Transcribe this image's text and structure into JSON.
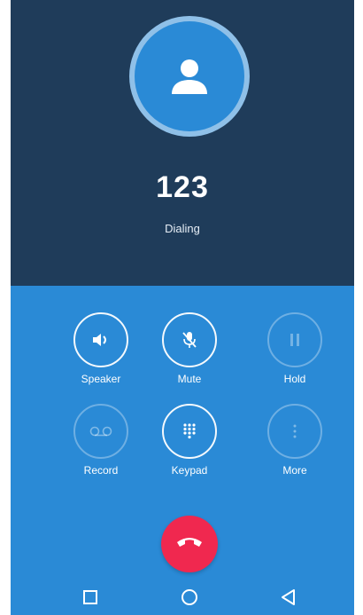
{
  "call": {
    "number": "123",
    "status": "Dialing"
  },
  "controls": {
    "speaker": {
      "label": "Speaker",
      "icon": "speaker-icon",
      "enabled": true
    },
    "mute": {
      "label": "Mute",
      "icon": "mic-off-icon",
      "enabled": true
    },
    "hold": {
      "label": "Hold",
      "icon": "pause-icon",
      "enabled": false
    },
    "record": {
      "label": "Record",
      "icon": "voicemail-icon",
      "enabled": false
    },
    "keypad": {
      "label": "Keypad",
      "icon": "dialpad-icon",
      "enabled": true
    },
    "more": {
      "label": "More",
      "icon": "more-vertical-icon",
      "enabled": false
    }
  },
  "end_call": {
    "icon": "end-call-icon"
  },
  "navbar": {
    "recents": {
      "icon": "square-icon"
    },
    "home": {
      "icon": "circle-icon"
    },
    "back": {
      "icon": "triangle-back-icon"
    }
  },
  "colors": {
    "top_bg": "#1f3c5a",
    "bottom_bg": "#2a8ad6",
    "avatar_ring": "#8fc0e8",
    "end_call": "#f0284f"
  }
}
